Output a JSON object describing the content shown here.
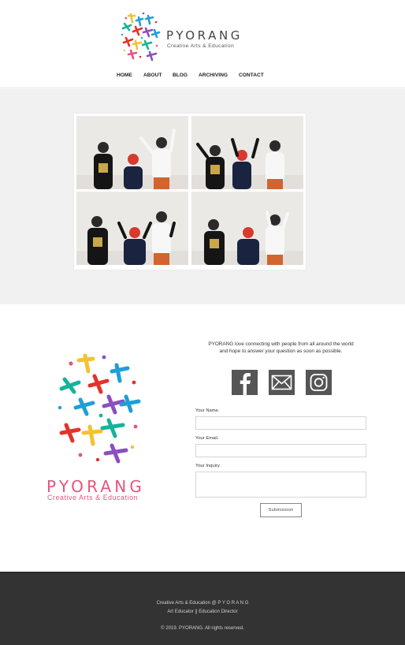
{
  "brand": {
    "name": "PYORANG",
    "tagline": "Creative Arts & Education",
    "colors": {
      "pink": "#e8537d",
      "blue": "#1e9fd8",
      "yellow": "#f2c230",
      "purple": "#8b4fbf",
      "red": "#e4322b",
      "teal": "#15b39b",
      "green": "#5cb85c"
    }
  },
  "nav": {
    "items": [
      {
        "label": "HOME"
      },
      {
        "label": "ABOUT"
      },
      {
        "label": "BLOG"
      },
      {
        "label": "ARCHIVING"
      },
      {
        "label": "CONTACT"
      }
    ]
  },
  "gallery": {
    "photos": [
      {
        "icon": "photo-kids-1"
      },
      {
        "icon": "photo-kids-2"
      },
      {
        "icon": "photo-kids-3"
      },
      {
        "icon": "photo-kids-4"
      }
    ]
  },
  "contact": {
    "intro_line1": "PYORANG love connecting with people from all around the world",
    "intro_line2": "and hope to answer your question as soon as possible.",
    "social": [
      {
        "icon": "facebook-icon"
      },
      {
        "icon": "email-icon"
      },
      {
        "icon": "instagram-icon"
      }
    ],
    "form": {
      "name_label": "Your Name.",
      "email_label": "Your Email.",
      "inquiry_label": "Your Inquiry.",
      "name_value": "",
      "email_value": "",
      "inquiry_value": "",
      "submit_label": "Submission"
    }
  },
  "footer": {
    "line1": "Creative Arts & Education @ P Y O R A N G",
    "line2": "Art Educator  ||  Education Director",
    "copyright": "© 2019. PYORANG. All rights reserved."
  }
}
